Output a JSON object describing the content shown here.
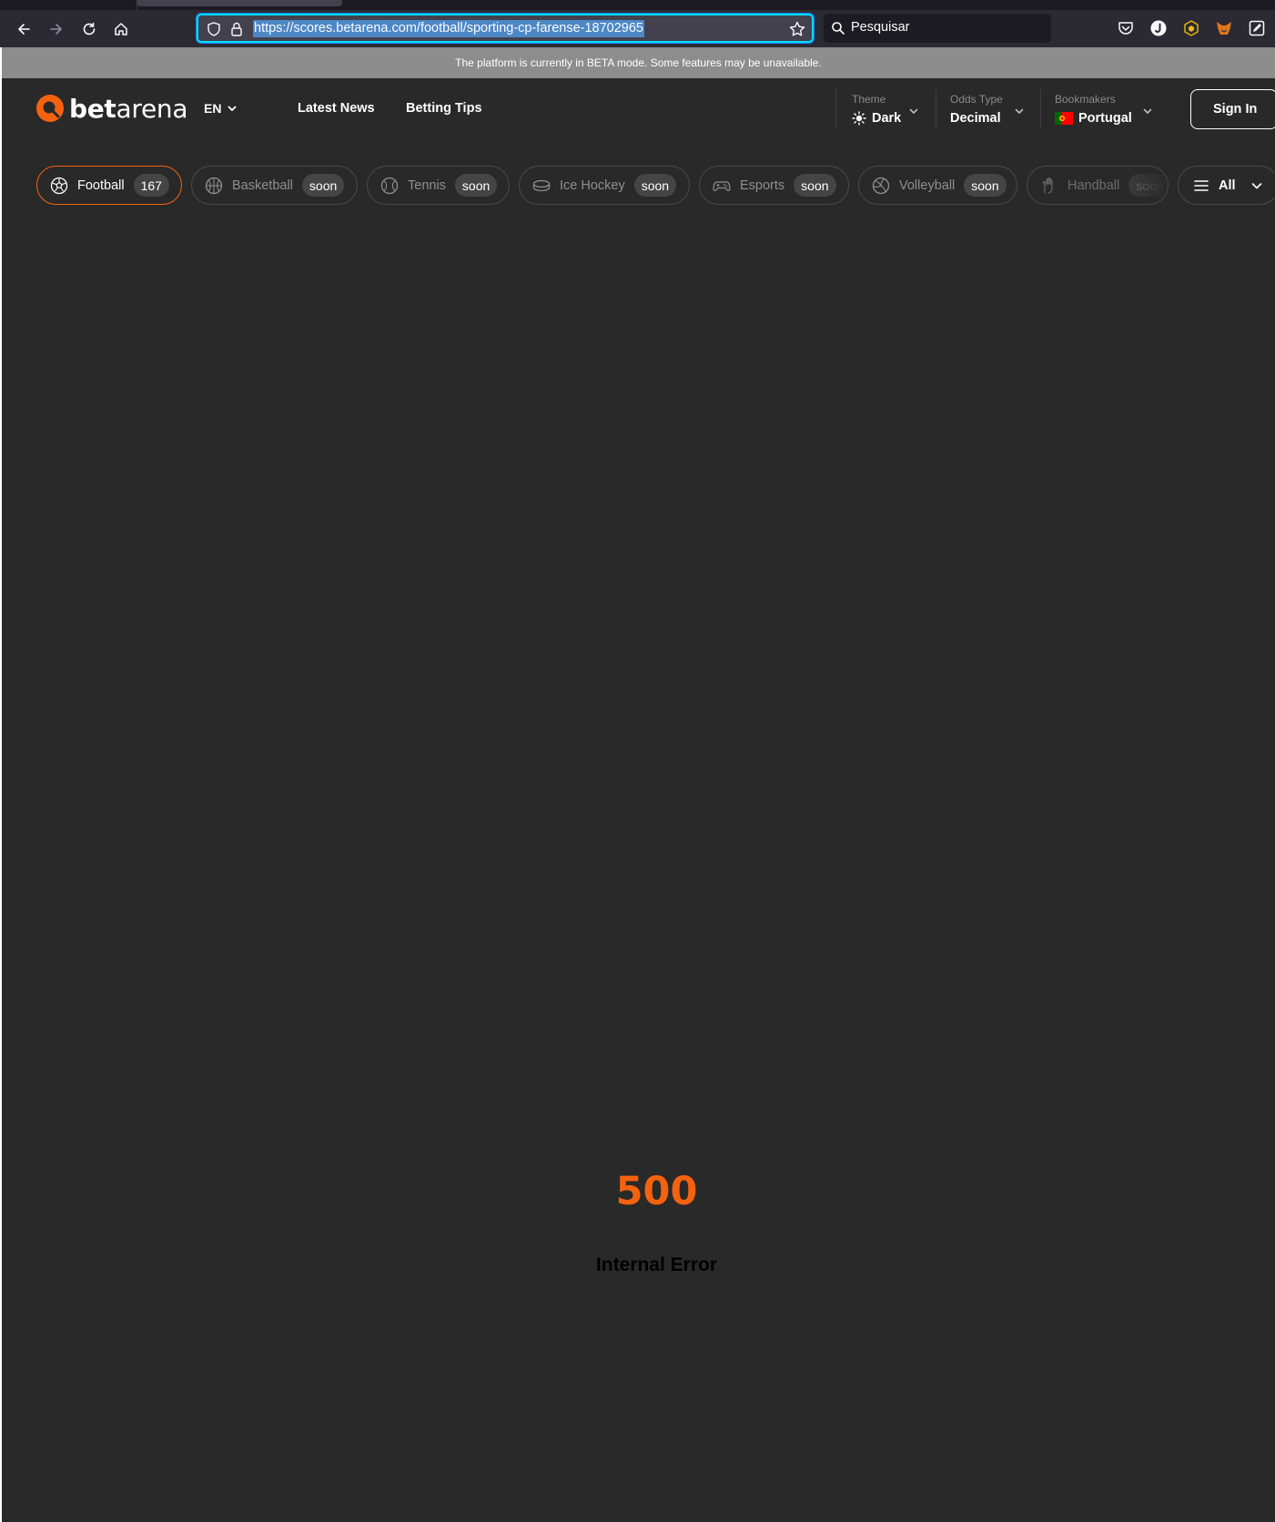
{
  "browser": {
    "url": "https://scores.betarena.com/football/sporting-cp-farense-18702965",
    "search_placeholder": "Pesquisar"
  },
  "banner": {
    "text": "The platform is currently in BETA mode. Some features may be unavailable."
  },
  "header": {
    "logo_bold": "bet",
    "logo_light": "arena",
    "language": "EN",
    "nav": {
      "news": "Latest News",
      "tips": "Betting Tips"
    },
    "theme": {
      "caption": "Theme",
      "value": "Dark"
    },
    "odds": {
      "caption": "Odds Type",
      "value": "Decimal"
    },
    "bookmakers": {
      "caption": "Bookmakers",
      "value": "Portugal"
    },
    "signin": "Sign In"
  },
  "sports": {
    "items": [
      {
        "label": "Football",
        "badge": "167",
        "icon": "football-icon",
        "active": true
      },
      {
        "label": "Basketball",
        "badge": "soon",
        "icon": "basketball-icon",
        "active": false
      },
      {
        "label": "Tennis",
        "badge": "soon",
        "icon": "tennis-icon",
        "active": false
      },
      {
        "label": "Ice Hockey",
        "badge": "soon",
        "icon": "ice-hockey-icon",
        "active": false
      },
      {
        "label": "Esports",
        "badge": "soon",
        "icon": "gamepad-icon",
        "active": false
      },
      {
        "label": "Volleyball",
        "badge": "soon",
        "icon": "volleyball-icon",
        "active": false
      },
      {
        "label": "Handball",
        "badge": "soon",
        "icon": "handball-icon",
        "active": false
      }
    ],
    "all_label": "All"
  },
  "error": {
    "code": "500",
    "message": "Internal Error"
  },
  "colors": {
    "accent": "#f5620f",
    "page_bg": "#292929",
    "banner_bg": "#8d8d8d"
  }
}
